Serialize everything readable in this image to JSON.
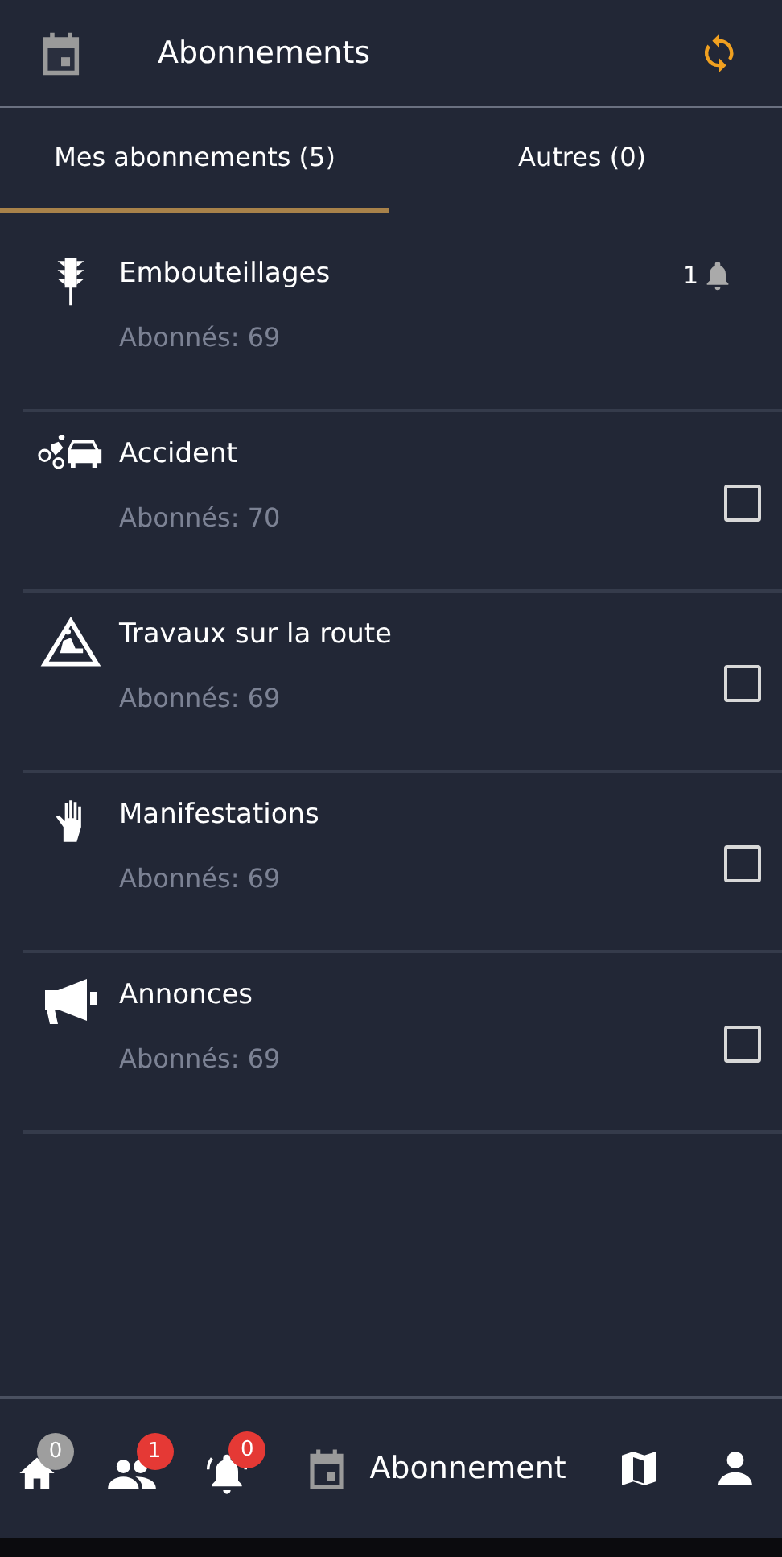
{
  "header": {
    "title": "Abonnements"
  },
  "tabs": [
    {
      "label": "Mes abonnements (5)",
      "selected": true
    },
    {
      "label": "Autres (0)",
      "selected": false
    }
  ],
  "subscriptions": [
    {
      "name": "Embouteillages",
      "subscribers": "Abonnés: 69",
      "kind": "bell",
      "count": "1"
    },
    {
      "name": "Accident",
      "subscribers": "Abonnés: 70",
      "kind": "checkbox",
      "checked": false
    },
    {
      "name": "Travaux sur la route",
      "subscribers": "Abonnés: 69",
      "kind": "checkbox",
      "checked": false
    },
    {
      "name": "Manifestations",
      "subscribers": "Abonnés: 69",
      "kind": "checkbox",
      "checked": false
    },
    {
      "name": "Annonces",
      "subscribers": "Abonnés: 69",
      "kind": "checkbox",
      "checked": false
    }
  ],
  "bottom_nav": [
    {
      "badge": "0",
      "color": "#9e9e9e",
      "selected": false
    },
    {
      "badge": "1",
      "color": "#e53935",
      "selected": false
    },
    {
      "badge": "0",
      "color": "#e53935",
      "selected": false
    },
    {
      "label": "Abonnement",
      "selected": true
    },
    {
      "selected": false
    },
    {
      "selected": false
    }
  ]
}
